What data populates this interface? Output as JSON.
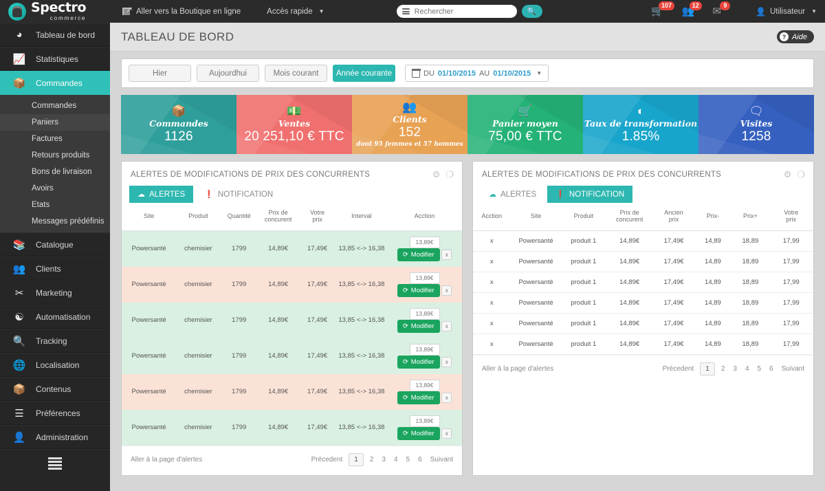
{
  "topbar": {
    "logo_main": "Spectro",
    "logo_sub": "commerce",
    "shop_link": "Aller vers la Boutique en ligne",
    "quick_access": "Accès rapide",
    "search_placeholder": "Rechercher",
    "search_value": "",
    "search_icon": "search-icon",
    "cart_badge": "107",
    "users_badge": "12",
    "mail_badge": "9",
    "user_label": "Utilisateur"
  },
  "sidebar": {
    "items": [
      {
        "label": "Tableau de bord",
        "icon": "gauge-icon",
        "active": false
      },
      {
        "label": "Statistiques",
        "icon": "chart-icon",
        "active": false
      },
      {
        "label": "Commandes",
        "icon": "open-box-icon",
        "active": true
      },
      {
        "label": "Catalogue",
        "icon": "books-icon",
        "active": false
      },
      {
        "label": "Clients",
        "icon": "people-icon",
        "active": false
      },
      {
        "label": "Marketing",
        "icon": "scissors-coupon-icon",
        "active": false
      },
      {
        "label": "Automatisation",
        "icon": "robot-icon",
        "active": false
      },
      {
        "label": "Tracking",
        "icon": "magnifier-chart-icon",
        "active": false
      },
      {
        "label": "Localisation",
        "icon": "globe-pin-icon",
        "active": false
      },
      {
        "label": "Contenus",
        "icon": "box-wrench-icon",
        "active": false
      },
      {
        "label": "Préférences",
        "icon": "sliders-icon",
        "active": false
      },
      {
        "label": "Administration",
        "icon": "user-gear-icon",
        "active": false
      }
    ],
    "submenu": [
      {
        "label": "Commandes",
        "highlight": false
      },
      {
        "label": "Paniers",
        "highlight": true
      },
      {
        "label": "Factures",
        "highlight": false
      },
      {
        "label": "Retours produits",
        "highlight": false
      },
      {
        "label": "Bons de livraison",
        "highlight": false
      },
      {
        "label": "Avoirs",
        "highlight": false
      },
      {
        "label": "Etats",
        "highlight": false
      },
      {
        "label": "Messages prédéfinis",
        "highlight": false
      }
    ],
    "toggle_icon": "hamburger-icon"
  },
  "page": {
    "title": "TABLEAU DE BORD",
    "help_label": "Aide"
  },
  "filters": {
    "buttons": [
      {
        "label": "Hier",
        "active": false
      },
      {
        "label": "Aujourdhui",
        "active": false
      },
      {
        "label": "Mois courant",
        "active": false
      },
      {
        "label": "Année courante",
        "active": true
      }
    ],
    "date_prefix": "DU",
    "date_from": "01/10/2015",
    "date_mid": "AU",
    "date_to": "01/10/2015",
    "calendar_icon": "calendar-icon"
  },
  "stats": [
    {
      "label": "Commandes",
      "value": "1126",
      "sub": "",
      "icon": "open-box-icon",
      "color": "#2f9f9b"
    },
    {
      "label": "Ventes",
      "value": "20 251,10 € TTC",
      "sub": "",
      "icon": "banknote-icon",
      "color": "#f0706f"
    },
    {
      "label": "Clients",
      "value": "152",
      "sub": "dont 95 femmes et 57 hommes",
      "icon": "people-icon",
      "color": "#e8a254"
    },
    {
      "label": "Panier moyen",
      "value": "75,00 € TTC",
      "sub": "",
      "icon": "basket-icon",
      "color": "#24b277"
    },
    {
      "label": "Taux de transformation",
      "value": "1.85%",
      "sub": "",
      "icon": "pie-icon",
      "color": "#18a5cb"
    },
    {
      "label": "Visites",
      "value": "1258",
      "sub": "",
      "icon": "visitor-card-icon",
      "color": "#3560c0"
    }
  ],
  "left_panel": {
    "title": "ALERTES DE MODIFICATIONS DE PRIX DES CONCURRENTS",
    "gear_icon": "gear-icon",
    "close_icon": "close-circle-icon",
    "tabs": [
      {
        "label": "ALERTES",
        "icon": "alert-cloud-icon",
        "active": true
      },
      {
        "label": "NOTIFICATION",
        "icon": "info-icon",
        "active": false
      }
    ],
    "columns": [
      "Site",
      "Produit",
      "Quantité",
      "Prix de concurent",
      "Votre prix",
      "Interval",
      "Acction"
    ],
    "rows": [
      {
        "tone": "g",
        "site": "Powersanté",
        "produit": "chemisier",
        "quantite": "1799",
        "prix_concurrent": "14,89€",
        "votre_prix": "17,49€",
        "interval": "13,85 <-> 16,38"
      },
      {
        "tone": "p",
        "site": "Powersanté",
        "produit": "chemisier",
        "quantite": "1799",
        "prix_concurrent": "14,89€",
        "votre_prix": "17,49€",
        "interval": "13,85 <-> 16,38"
      },
      {
        "tone": "g",
        "site": "Powersanté",
        "produit": "chemisier",
        "quantite": "1799",
        "prix_concurrent": "14,89€",
        "votre_prix": "17,49€",
        "interval": "13,85 <-> 16,38"
      },
      {
        "tone": "g",
        "site": "Powersanté",
        "produit": "chemisier",
        "quantite": "1799",
        "prix_concurrent": "14,89€",
        "votre_prix": "17,49€",
        "interval": "13,85 <-> 16,38"
      },
      {
        "tone": "p",
        "site": "Powersanté",
        "produit": "chemisier",
        "quantite": "1799",
        "prix_concurrent": "14,89€",
        "votre_prix": "17,49€",
        "interval": "13,85 <-> 16,38"
      },
      {
        "tone": "g",
        "site": "Powersanté",
        "produit": "chemisier",
        "quantite": "1799",
        "prix_concurrent": "14,89€",
        "votre_prix": "17,49€",
        "interval": "13,85 <-> 16,38"
      }
    ],
    "input_placeholder": "13,89€",
    "modify_label": "Modifier",
    "modify_icon": "refresh-icon",
    "delete_label": "x",
    "pager": {
      "goto": "Aller à la page d'alertes",
      "prev": "Précedent",
      "next": "Suivant",
      "pages": [
        "1",
        "2",
        "3",
        "4",
        "5",
        "6"
      ],
      "current": "1"
    }
  },
  "right_panel": {
    "title": "ALERTES DE MODIFICATIONS DE PRIX DES CONCURRENTS",
    "gear_icon": "gear-icon",
    "close_icon": "close-circle-icon",
    "tabs": [
      {
        "label": "ALERTES",
        "icon": "alert-cloud-icon",
        "active": false
      },
      {
        "label": "NOTIFICATION",
        "icon": "info-icon",
        "active": true
      }
    ],
    "columns": [
      "Acction",
      "Site",
      "Produit",
      "Prix de concurent",
      "Ancien prix",
      "Prix-",
      "Prix+",
      "Votre prix"
    ],
    "rows": [
      {
        "action": "x",
        "site": "Powersanté",
        "produit": "produit 1",
        "prix_concurrent": "14,89€",
        "ancien_prix": "17,49€",
        "prix_moins": "14,89",
        "prix_plus": "18,89",
        "votre_prix": "17,99"
      },
      {
        "action": "x",
        "site": "Powersanté",
        "produit": "produit 1",
        "prix_concurrent": "14,89€",
        "ancien_prix": "17,49€",
        "prix_moins": "14,89",
        "prix_plus": "18,89",
        "votre_prix": "17,99"
      },
      {
        "action": "x",
        "site": "Powersanté",
        "produit": "produit 1",
        "prix_concurrent": "14,89€",
        "ancien_prix": "17,49€",
        "prix_moins": "14,89",
        "prix_plus": "18,89",
        "votre_prix": "17,99"
      },
      {
        "action": "x",
        "site": "Powersanté",
        "produit": "produit 1",
        "prix_concurrent": "14,89€",
        "ancien_prix": "17,49€",
        "prix_moins": "14,89",
        "prix_plus": "18,89",
        "votre_prix": "17,99"
      },
      {
        "action": "x",
        "site": "Powersanté",
        "produit": "produit 1",
        "prix_concurrent": "14,89€",
        "ancien_prix": "17,49€",
        "prix_moins": "14,89",
        "prix_plus": "18,89",
        "votre_prix": "17,99"
      },
      {
        "action": "x",
        "site": "Powersanté",
        "produit": "produit 1",
        "prix_concurrent": "14,89€",
        "ancien_prix": "17,49€",
        "prix_moins": "14,89",
        "prix_plus": "18,89",
        "votre_prix": "17,99"
      }
    ],
    "pager": {
      "goto": "Aller à la page d'alertes",
      "prev": "Précedent",
      "next": "Suivant",
      "pages": [
        "1",
        "2",
        "3",
        "4",
        "5",
        "6"
      ],
      "current": "1"
    }
  },
  "colors": {
    "accent": "#2cb7b0",
    "danger": "#e8453c",
    "green": "#1aa45e",
    "link": "#2d9cc9"
  }
}
